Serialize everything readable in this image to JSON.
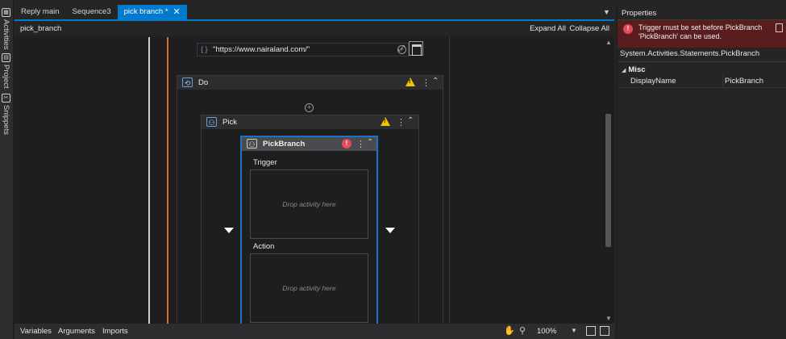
{
  "left_panel": {
    "tabs": [
      {
        "label": "Activities",
        "icon": "activities-icon"
      },
      {
        "label": "Project",
        "icon": "project-icon"
      },
      {
        "label": "Snippets",
        "icon": "snippets-icon"
      }
    ]
  },
  "tabs": [
    {
      "label": "Reply main"
    },
    {
      "label": "Sequence3"
    },
    {
      "label": "pick branch *",
      "active": true
    }
  ],
  "breadcrumb": "pick_branch",
  "toolbar": {
    "expand_all": "Expand All",
    "collapse_all": "Collapse All"
  },
  "designer": {
    "url_value": "\"https://www.nairaland.com/\"",
    "do": {
      "title": "Do",
      "warning": true
    },
    "pick": {
      "title": "Pick",
      "warning": true
    },
    "pick_branch": {
      "title": "PickBranch",
      "error": true,
      "trigger_label": "Trigger",
      "action_label": "Action",
      "drop_placeholder": "Drop activity here"
    }
  },
  "bottom": {
    "variables": "Variables",
    "arguments": "Arguments",
    "imports": "Imports",
    "zoom": "100%"
  },
  "properties": {
    "title": "Properties",
    "error_message": "Trigger must be set before PickBranch 'PickBranch' can be used.",
    "type_name": "System.Activities.Statements.PickBranch",
    "category": "Misc",
    "rows": [
      {
        "name": "DisplayName",
        "value": "PickBranch"
      }
    ]
  },
  "colors": {
    "accent": "#007acc",
    "warning": "#f0c400",
    "error": "#e14b5a",
    "error_banner": "#5a1d1d",
    "selected_border": "#1c74c8",
    "vertical_line_orange": "#d86b2a"
  }
}
